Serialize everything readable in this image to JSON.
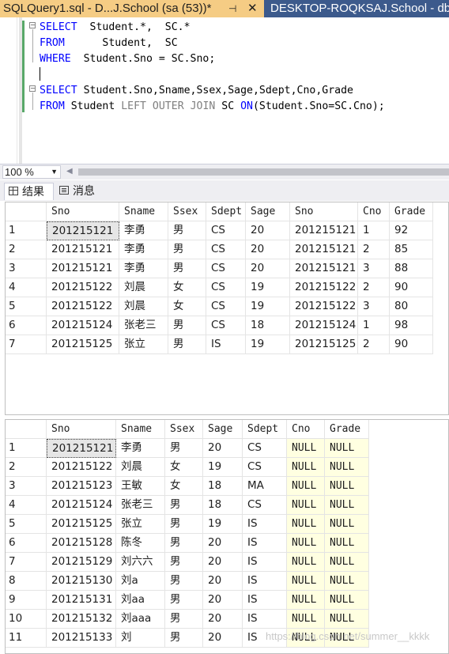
{
  "tabs": {
    "active": "SQLQuery1.sql - D...J.School (sa (53))*",
    "pin": "⊣",
    "close": "✕",
    "inactive": "DESKTOP-ROQKSAJ.School - dbo"
  },
  "editor": {
    "line1": {
      "kw1": "SELECT",
      "rest": "  Student.*,  SC.*"
    },
    "line2": {
      "kw1": "FROM",
      "rest": "      Student,  SC"
    },
    "line3": {
      "kw1": "WHERE",
      "rest": "  Student.Sno = SC.Sno;"
    },
    "line5": {
      "kw1": "SELECT",
      "rest": " Student.Sno,Sname,Ssex,Sage,Sdept,Cno,Grade"
    },
    "line6": {
      "kw1": "FROM",
      "mid": " Student ",
      "join": "LEFT OUTER JOIN",
      "sc": " SC ",
      "on": "ON",
      "paren": "(Student.Sno=SC.Cno);"
    }
  },
  "zoom": {
    "value": "100 %"
  },
  "result_tabs": {
    "results": "结果",
    "messages": "消息"
  },
  "grid1": {
    "columns": [
      "Sno",
      "Sname",
      "Ssex",
      "Sdept",
      "Sage",
      "Sno",
      "Cno",
      "Grade"
    ],
    "rows": [
      [
        "1",
        "201215121",
        "李勇",
        "男",
        "CS",
        "20",
        "201215121",
        "1",
        "92"
      ],
      [
        "2",
        "201215121",
        "李勇",
        "男",
        "CS",
        "20",
        "201215121",
        "2",
        "85"
      ],
      [
        "3",
        "201215121",
        "李勇",
        "男",
        "CS",
        "20",
        "201215121",
        "3",
        "88"
      ],
      [
        "4",
        "201215122",
        "刘晨",
        "女",
        "CS",
        "19",
        "201215122",
        "2",
        "90"
      ],
      [
        "5",
        "201215122",
        "刘晨",
        "女",
        "CS",
        "19",
        "201215122",
        "3",
        "80"
      ],
      [
        "6",
        "201215124",
        "张老三",
        "男",
        "CS",
        "18",
        "201215124",
        "1",
        "98"
      ],
      [
        "7",
        "201215125",
        "张立",
        "男",
        "IS",
        "19",
        "201215125",
        "2",
        "90"
      ]
    ]
  },
  "grid2": {
    "columns": [
      "Sno",
      "Sname",
      "Ssex",
      "Sage",
      "Sdept",
      "Cno",
      "Grade"
    ],
    "rows": [
      [
        "1",
        "201215121",
        "李勇",
        "男",
        "20",
        "CS",
        "NULL",
        "NULL"
      ],
      [
        "2",
        "201215122",
        "刘晨",
        "女",
        "19",
        "CS",
        "NULL",
        "NULL"
      ],
      [
        "3",
        "201215123",
        "王敏",
        "女",
        "18",
        "MA",
        "NULL",
        "NULL"
      ],
      [
        "4",
        "201215124",
        "张老三",
        "男",
        "18",
        "CS",
        "NULL",
        "NULL"
      ],
      [
        "5",
        "201215125",
        "张立",
        "男",
        "19",
        "IS",
        "NULL",
        "NULL"
      ],
      [
        "6",
        "201215128",
        "陈冬",
        "男",
        "20",
        "IS",
        "NULL",
        "NULL"
      ],
      [
        "7",
        "201215129",
        "刘六六",
        "男",
        "20",
        "IS",
        "NULL",
        "NULL"
      ],
      [
        "8",
        "201215130",
        "刘a",
        "男",
        "20",
        "IS",
        "NULL",
        "NULL"
      ],
      [
        "9",
        "201215131",
        "刘aa",
        "男",
        "20",
        "IS",
        "NULL",
        "NULL"
      ],
      [
        "10",
        "201215132",
        "刘aaa",
        "男",
        "20",
        "IS",
        "NULL",
        "NULL"
      ],
      [
        "11",
        "201215133",
        "刘",
        "男",
        "20",
        "IS",
        "NULL",
        "NULL"
      ]
    ]
  },
  "watermark": "https://blog.csdn.net/summer__kkkk",
  "colors": {
    "tab_active": "#f5cc84",
    "tabbar": "#3c5a8c",
    "keyword": "#0000ff",
    "null_cell": "#ffffe1"
  }
}
